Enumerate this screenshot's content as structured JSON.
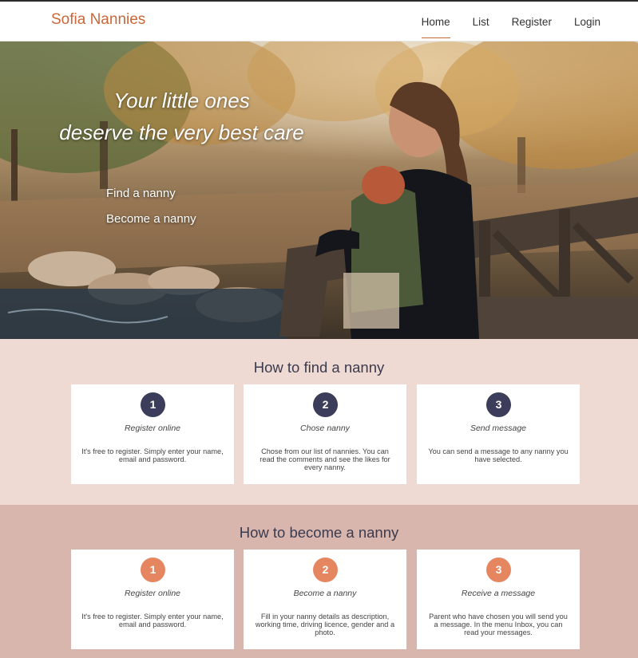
{
  "brand": "Sofia Nannies",
  "nav": {
    "home": "Home",
    "list": "List",
    "register": "Register",
    "login": "Login"
  },
  "hero": {
    "title_line1": "Your little ones",
    "title_line2": "deserve the very best care",
    "link_find": "Find a nanny",
    "link_become": "Become a nanny"
  },
  "find_section": {
    "title": "How to find a nanny",
    "steps": [
      {
        "number": "1",
        "title": "Register online",
        "text": "It's free to register. Simply enter your name, email and password."
      },
      {
        "number": "2",
        "title": "Chose nanny",
        "text": "Chose from our list of nannies. You can read the comments and see the likes for every nanny."
      },
      {
        "number": "3",
        "title": "Send message",
        "text": "You can send a message to any nanny you have selected."
      }
    ]
  },
  "become_section": {
    "title": "How to become a nanny",
    "steps": [
      {
        "number": "1",
        "title": "Register online",
        "text": "It's free to register. Simply enter your name, email and password."
      },
      {
        "number": "2",
        "title": "Become a nanny",
        "text": "Fill in your nanny details as description, working time, driving licence, gender and a photo."
      },
      {
        "number": "3",
        "title": "Receive a message",
        "text": "Parent who have chosen you will send you a message. In the menu Inbox, you can read your messages."
      }
    ]
  },
  "colors": {
    "brand": "#c8683a",
    "find_bg": "#eedad2",
    "become_bg": "#d8b6ae",
    "badge_dark": "#3b3d5a",
    "badge_orange": "#e58661"
  }
}
